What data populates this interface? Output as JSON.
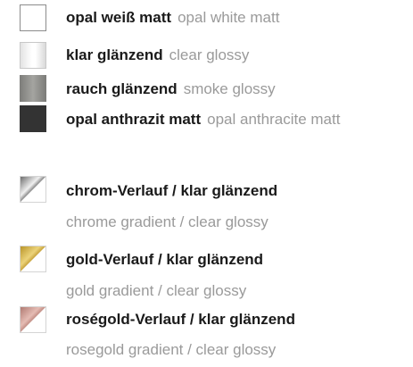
{
  "finishes": [
    {
      "de": "opal weiß matt",
      "en": "opal white matt",
      "swatch_icon": "opal-white-matt-swatch",
      "color": "#ffffff"
    },
    {
      "de": "klar glänzend",
      "en": "clear glossy",
      "swatch_icon": "clear-glossy-swatch",
      "color": "#f2f2f2"
    },
    {
      "de": "rauch glänzend",
      "en": "smoke glossy",
      "swatch_icon": "smoke-glossy-swatch",
      "color": "#8f8f8c"
    },
    {
      "de": "opal anthrazit matt",
      "en": "opal anthracite matt",
      "swatch_icon": "opal-anthracite-matt-swatch",
      "color": "#333333"
    }
  ],
  "gradients": [
    {
      "de": "chrom-Verlauf / klar glänzend",
      "en": "chrome gradient / clear glossy",
      "swatch_icon": "chrome-gradient-swatch",
      "color": "#a8a8a8"
    },
    {
      "de": "gold-Verlauf / klar glänzend",
      "en": "gold gradient / clear glossy",
      "swatch_icon": "gold-gradient-swatch",
      "color": "#d9b84f"
    },
    {
      "de": "roségold-Verlauf / klar glänzend",
      "en": "rosegold gradient / clear glossy",
      "swatch_icon": "rosegold-gradient-swatch",
      "color": "#d4a19a"
    }
  ]
}
